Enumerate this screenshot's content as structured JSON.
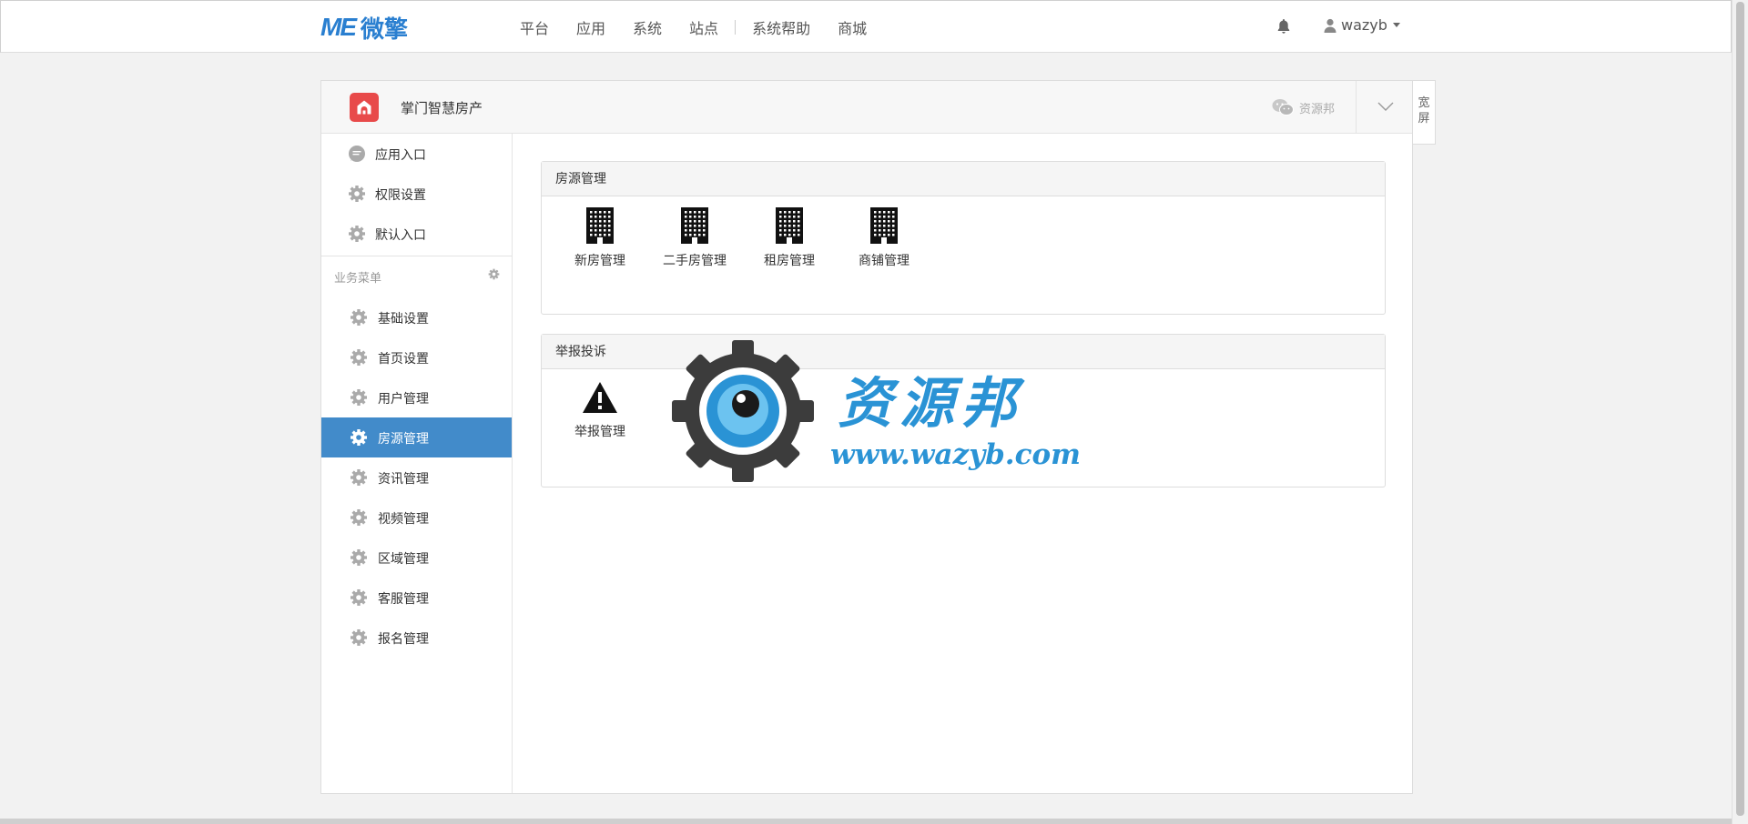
{
  "brand": {
    "logo_mark": "ME",
    "logo_text": "微擎"
  },
  "topnav": {
    "items": [
      "平台",
      "应用",
      "系统",
      "站点",
      "系统帮助",
      "商城"
    ]
  },
  "user": {
    "name": "wazyb"
  },
  "app": {
    "name": "掌门智慧房产",
    "icon": "house-icon",
    "icon_color": "#e84a4a",
    "wechat_account": "资源邦"
  },
  "widescreen": {
    "label": "宽屏"
  },
  "sidebar": {
    "top_items": [
      {
        "label": "应用入口",
        "icon": "chat-icon"
      },
      {
        "label": "权限设置",
        "icon": "gear-icon"
      },
      {
        "label": "默认入口",
        "icon": "gear-icon"
      }
    ],
    "group_label": "业务菜单",
    "menu_items": [
      {
        "label": "基础设置",
        "icon": "gear-icon"
      },
      {
        "label": "首页设置",
        "icon": "gear-icon"
      },
      {
        "label": "用户管理",
        "icon": "gear-icon"
      },
      {
        "label": "房源管理",
        "icon": "gear-icon",
        "active": true
      },
      {
        "label": "资讯管理",
        "icon": "gear-icon"
      },
      {
        "label": "视频管理",
        "icon": "gear-icon"
      },
      {
        "label": "区域管理",
        "icon": "gear-icon"
      },
      {
        "label": "客服管理",
        "icon": "gear-icon"
      },
      {
        "label": "报名管理",
        "icon": "gear-icon"
      }
    ],
    "active_color": "#428bca"
  },
  "sections": [
    {
      "title": "房源管理",
      "tiles": [
        {
          "label": "新房管理",
          "icon": "building-icon"
        },
        {
          "label": "二手房管理",
          "icon": "building-icon"
        },
        {
          "label": "租房管理",
          "icon": "building-icon"
        },
        {
          "label": "商铺管理",
          "icon": "building-icon"
        }
      ]
    },
    {
      "title": "举报投诉",
      "tiles": [
        {
          "label": "举报管理",
          "icon": "warning-icon"
        }
      ]
    }
  ],
  "watermark": {
    "title": "资源邦",
    "url": "www.wazyb.com"
  }
}
